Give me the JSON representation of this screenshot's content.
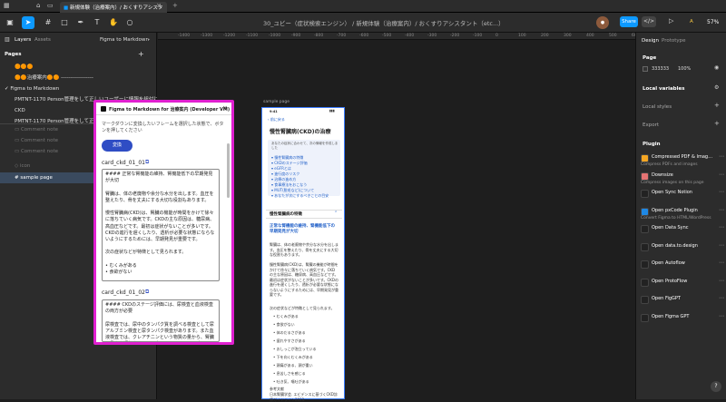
{
  "browser_tab": {
    "title": "新規体験（治療案内）/ おくすりアシスタ"
  },
  "toolbar": {
    "doc_title": "30_ユビー（症状検索エンジン） / 新規体験（治療案内）/ おくすりアシスタント（etc...）",
    "share_label": "Share",
    "zoom": "57%",
    "avatar_initials": "A"
  },
  "left_panel": {
    "tab_layers": "Layers",
    "tab_assets": "Assets",
    "file_name": "Figma to Markdown",
    "pages_heading": "Pages",
    "pages": [
      "🟠🟠🟠",
      "🟠🟠治療案内🟠🟠 ------------------",
      "Figma to Markdown",
      "PMTNT-1170 Person管理をして正しいユーザーに情報を紐付け",
      "CKD",
      "PMTNT-1170 Person管理をして正しいユーザーに情報を紐付け"
    ],
    "active_page_index": 2,
    "layers": [
      "Comment note",
      "Comment note",
      "Comment note",
      "icon",
      "sample page"
    ]
  },
  "ruler": {
    "ticks": [
      "-1400",
      "-1300",
      "-1200",
      "-1100",
      "-1000",
      "-900",
      "-800",
      "-700",
      "-600",
      "-500",
      "-400",
      "-300",
      "-200",
      "-100",
      "0",
      "100",
      "200",
      "300",
      "400",
      "500",
      "600"
    ]
  },
  "canvas": {
    "frame_label": "sample page"
  },
  "modal": {
    "title": "Figma to Markdown for 治療案内 (Developer VM)",
    "description": "マークダウンに変換したいフレームを選択した状態で、ボタンを押してください",
    "convert_label": "変換",
    "cards": [
      {
        "id": "card_ckd_01_01",
        "text": "#### 正常な腎機能の維持、腎機能低下の早期発見が大切\n\n腎臓は、体の老廃物や余分な水分を出します。血圧を整えたり、骨を丈夫にする大切な役割もあります。\n\n慢性腎臓病(CKD)は、腎臓の機能が時間をかけて徐々に落ちていく病気です。CKDの主な原因は、糖尿病、高血圧などです。最初は症状がないことが多いです。CKDの進行を遅くしたり、透析が必要な状態にならないようにするためには、早期発見が重要です。\n\n次の症状などが特徴として見られます。\n\n• むくみがある\n• 食欲がない"
      },
      {
        "id": "card_ckd_01_02",
        "text": "#### CKDのステージ評価には、尿検査と血液検査の両方が必要\n\n尿検査では、尿中のタンパク質を調べる検査として尿アルブミン検査と尿タンパク検査があります。また血液検査では、クレアチニンという物質の量から、腎臓の働きを評価するeGFR（イージーエフアール）"
      }
    ]
  },
  "phone": {
    "time": "9:41",
    "back_label": "前に戻る",
    "page_title": "慢性腎臓病(CKD)の治療",
    "toc_intro": "あなたの症状に合わせて、次の情報を作成しました",
    "toc": [
      "慢性腎臓病の特徴",
      "CKDのステージ評価",
      "eGFRとは",
      "進行度のリスク",
      "治療の進め方",
      "食事療法をおこなう",
      "MUT(脱毛など)について",
      "あなたが次にするべきことの目安"
    ],
    "section_title": "慢性腎臓病の特徴",
    "highlight": "正常な腎機能の維持、腎機能低下の早期発見が大切",
    "para1": "腎臓は、体の老廃物や余分な水分を出します。血圧を整えたり、骨を丈夫にする大切な役割もあります。",
    "para2": "慢性腎臓病(CKD)は、腎臓の機能が時間をかけて徐々に落ちていく病気です。CKDの主な原因は、糖尿病、高血圧などです。最初は症状がないことが多いです。CKDの進行を遅くしたり、透析が必要な状態にならないようにするためには、早期発見が重要です。",
    "para3": "次の症状などが特徴として見られます。",
    "bullets": [
      "むくみがある",
      "食欲がない",
      "体のだるさがある",
      "疲れやすさがある",
      "おしっこが泡立っている",
      "下を向くむくみがある",
      "頭痛がある、頭が重い",
      "息苦しさを感じる",
      "吐き気、嘔吐がある"
    ],
    "ref_label": "参考文献",
    "ref_text": "日本腎臓学会. エビデンスに基づくCKD診療ガイドライン2023."
  },
  "right_panel": {
    "tab_design": "Design",
    "tab_prototype": "Prototype",
    "page_heading": "Page",
    "page_color": "333333",
    "page_opacity": "100%",
    "local_variables": "Local variables",
    "local_styles": "Local styles",
    "export": "Export",
    "plugin_heading": "Plugin",
    "plugins": [
      {
        "name": "Compressed PDF & Imag…",
        "desc": "Compress PDFs and images",
        "color": "#f5a623"
      },
      {
        "name": "Downsize",
        "desc": "Compress images on this page",
        "color": "#e57373"
      },
      {
        "name": "Open Sync Notion",
        "desc": "",
        "color": "#222222"
      },
      {
        "name": "Open pxCode Plugin",
        "desc": "Convert Figma to HTML/WordPress",
        "color": "#1e88e5"
      },
      {
        "name": "Open Data Sync",
        "desc": "",
        "color": "#222222"
      },
      {
        "name": "Open data.to.design",
        "desc": "",
        "color": "#222222"
      },
      {
        "name": "Open Autoflow",
        "desc": "",
        "color": "#222222"
      },
      {
        "name": "Open ProtoFlow",
        "desc": "",
        "color": "#222222"
      },
      {
        "name": "Open FigGPT",
        "desc": "",
        "color": "#222222"
      },
      {
        "name": "Open Figma GPT",
        "desc": "",
        "color": "#222222"
      }
    ],
    "help_label": "?"
  },
  "colors": {
    "accent": "#0d99ff",
    "modal_border": "#e020d0",
    "convert_button": "#2f4dc4",
    "link": "#2563c9"
  }
}
